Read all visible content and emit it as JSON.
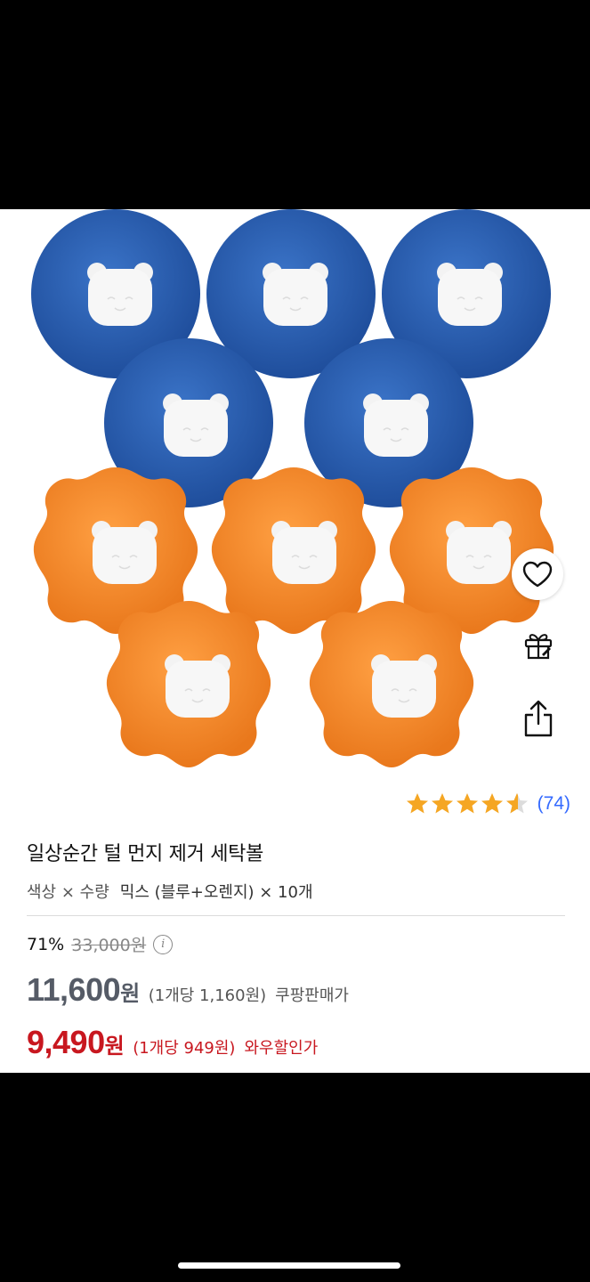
{
  "product": {
    "title": "일상순간 털 먼지 제거 세탁볼",
    "option_label": "색상 × 수량",
    "option_value": "믹스 (블루+오렌지) × 10개",
    "rating_stars": 4.5,
    "review_count": "(74)"
  },
  "pricing": {
    "discount_rate": "71%",
    "original_price": "33,000원",
    "info_icon": "i",
    "sale_price_number": "11,600",
    "sale_price_won": "원",
    "sale_unit_price": "(1개당 1,160원)",
    "sale_label": "쿠팡판매가",
    "wow_price_number": "9,490",
    "wow_price_won": "원",
    "wow_unit_price": "(1개당 949원)",
    "wow_label": "와우할인가"
  },
  "icons": {
    "heart": "heart-icon",
    "gift": "gift-icon",
    "share": "share-icon",
    "star": "star-icon"
  },
  "colors": {
    "blue_ball": "#2a5fb0",
    "orange_ball": "#f08a2a",
    "star": "#f5a623",
    "review_link": "#346aff",
    "wow_red": "#c8171f"
  }
}
